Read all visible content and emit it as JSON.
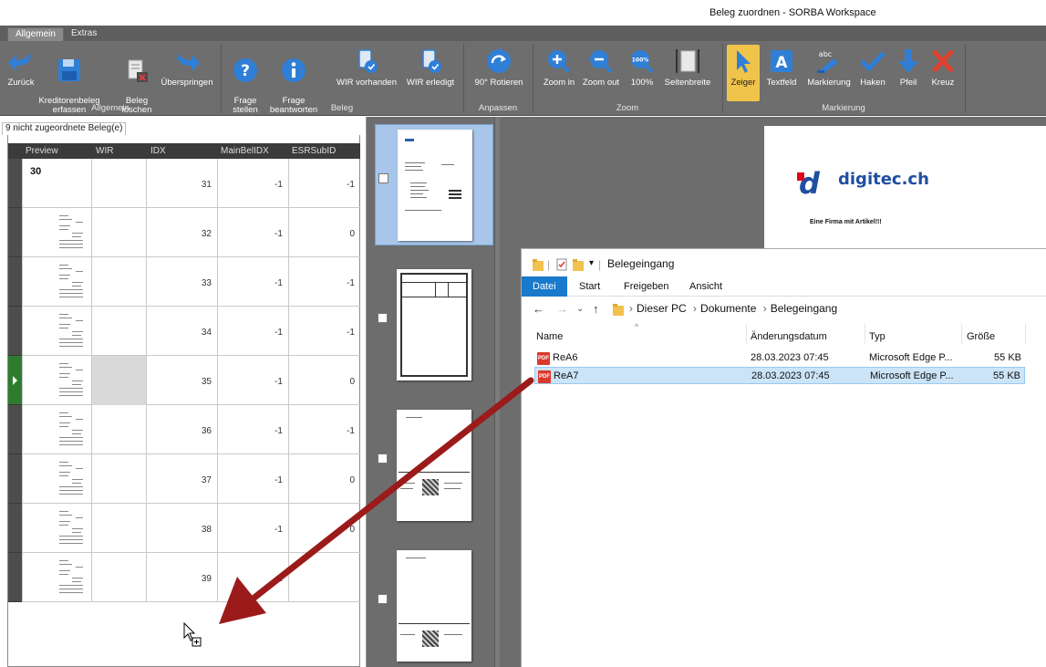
{
  "window": {
    "title": "Beleg zuordnen - SORBA Workspace"
  },
  "ribbon": {
    "tabs": [
      {
        "label": "Allgemein",
        "active": true
      },
      {
        "label": "Extras",
        "active": false
      }
    ],
    "buttons": {
      "zurueck": "Zurück",
      "kreditorenbeleg": "Kreditorenbeleg\nerfassen",
      "beleg_loeschen": "Beleg\nlöschen",
      "ueberspringen": "Überspringen",
      "frage_stellen": "Frage\nstellen",
      "frage_beantworten": "Frage\nbeantworten",
      "wir_vorhanden": "WIR vorhanden",
      "wir_erledigt": "WIR erledigt",
      "rotieren": "90° Rotieren",
      "zoom_in": "Zoom in",
      "zoom_out": "Zoom out",
      "zoom_100": "100%",
      "seitenbreite": "Seitenbreite",
      "zeiger": "Zeiger",
      "textfeld": "Textfeld",
      "markierung": "Markierung",
      "haken": "Haken",
      "pfeil": "Pfeil",
      "kreuz": "Kreuz"
    },
    "groups": {
      "allgemein": "Allgemein",
      "beleg": "Beleg",
      "anpassen": "Anpassen",
      "zoom": "Zoom",
      "markierung": "Markierung"
    },
    "icon_labels": {
      "zoom_100_icon": "100%",
      "markierung_icon": "abc"
    }
  },
  "left_panel": {
    "tab_label": "9 nicht zugeordnete Beleg(e)",
    "columns": [
      "Preview",
      "WIR",
      "IDX",
      "MainBelIDX",
      "ESRSubID"
    ],
    "rows": [
      {
        "preview": "30",
        "idx": "31",
        "main": "-1",
        "esr": "-1"
      },
      {
        "preview": "",
        "idx": "32",
        "main": "-1",
        "esr": "0"
      },
      {
        "preview": "",
        "idx": "33",
        "main": "-1",
        "esr": "-1"
      },
      {
        "preview": "",
        "idx": "34",
        "main": "-1",
        "esr": "-1"
      },
      {
        "preview": "",
        "idx": "35",
        "main": "-1",
        "esr": "0"
      },
      {
        "preview": "",
        "idx": "36",
        "main": "-1",
        "esr": "-1"
      },
      {
        "preview": "",
        "idx": "37",
        "main": "-1",
        "esr": "0"
      },
      {
        "preview": "",
        "idx": "38",
        "main": "-1",
        "esr": "0"
      },
      {
        "preview": "",
        "idx": "39",
        "main": "-1",
        "esr": ""
      }
    ]
  },
  "document": {
    "logo_text": "digitec.ch",
    "logo_letter": "d",
    "tagline": "Eine Firma mit Artikel!!!"
  },
  "explorer": {
    "title": "Belegeingang",
    "menu": [
      "Datei",
      "Start",
      "Freigeben",
      "Ansicht"
    ],
    "path": [
      "Dieser PC",
      "Dokumente",
      "Belegeingang"
    ],
    "columns": {
      "name": "Name",
      "date": "Änderungsdatum",
      "type": "Typ",
      "size": "Größe"
    },
    "files": [
      {
        "name": "ReA6",
        "date": "28.03.2023 07:45",
        "type": "Microsoft Edge P...",
        "size": "55 KB",
        "selected": false
      },
      {
        "name": "ReA7",
        "date": "28.03.2023 07:45",
        "type": "Microsoft Edge P...",
        "size": "55 KB",
        "selected": true
      }
    ],
    "pdf_badge": "PDF"
  },
  "colors": {
    "ribbon_bg": "#6e6e6e",
    "accent_blue": "#1979ca",
    "active_tool": "#f0c34a",
    "drag_arrow": "#9b1b1b"
  }
}
